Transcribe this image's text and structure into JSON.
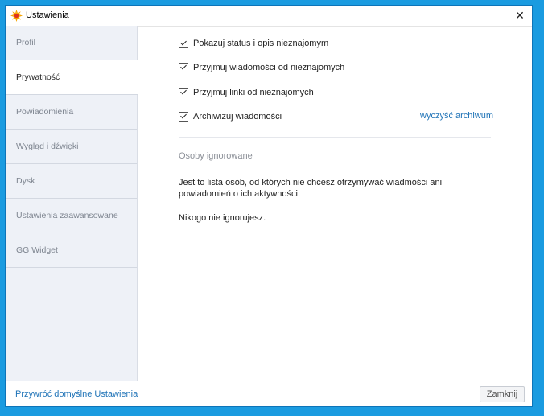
{
  "window": {
    "title": "Ustawienia",
    "close_glyph": "✕"
  },
  "sidebar": {
    "items": [
      {
        "label": "Profil"
      },
      {
        "label": "Prywatność"
      },
      {
        "label": "Powiadomienia"
      },
      {
        "label": "Wygląd i dźwięki"
      },
      {
        "label": "Dysk"
      },
      {
        "label": "Ustawienia zaawansowane"
      },
      {
        "label": "GG Widget"
      }
    ],
    "active_index": 1
  },
  "privacy": {
    "options": [
      {
        "label": "Pokazuj status i opis nieznajomym",
        "checked": true
      },
      {
        "label": "Przyjmuj wiadomości od nieznajomych",
        "checked": true
      },
      {
        "label": "Przyjmuj linki od nieznajomych",
        "checked": true
      },
      {
        "label": "Archiwizuj wiadomości",
        "checked": true
      }
    ],
    "clear_archive_link": "wyczyść archiwum",
    "ignored_section_title": "Osoby ignorowane",
    "ignored_description": "Jest to lista osób, od których nie chcesz otrzymywać wiadmości ani powiadomień o ich aktywności.",
    "ignored_empty": "Nikogo nie ignorujesz."
  },
  "footer": {
    "restore_link": "Przywróć domyślne Ustawienia",
    "close_button": "Zamknij"
  },
  "icons": {
    "app": "gg-sun-logo-icon",
    "close": "close-icon",
    "checkbox": "checkbox-checked-icon"
  },
  "colors": {
    "desktop": "#1a9be0",
    "link": "#1f73b7",
    "sidebar_bg": "#eef1f7"
  }
}
